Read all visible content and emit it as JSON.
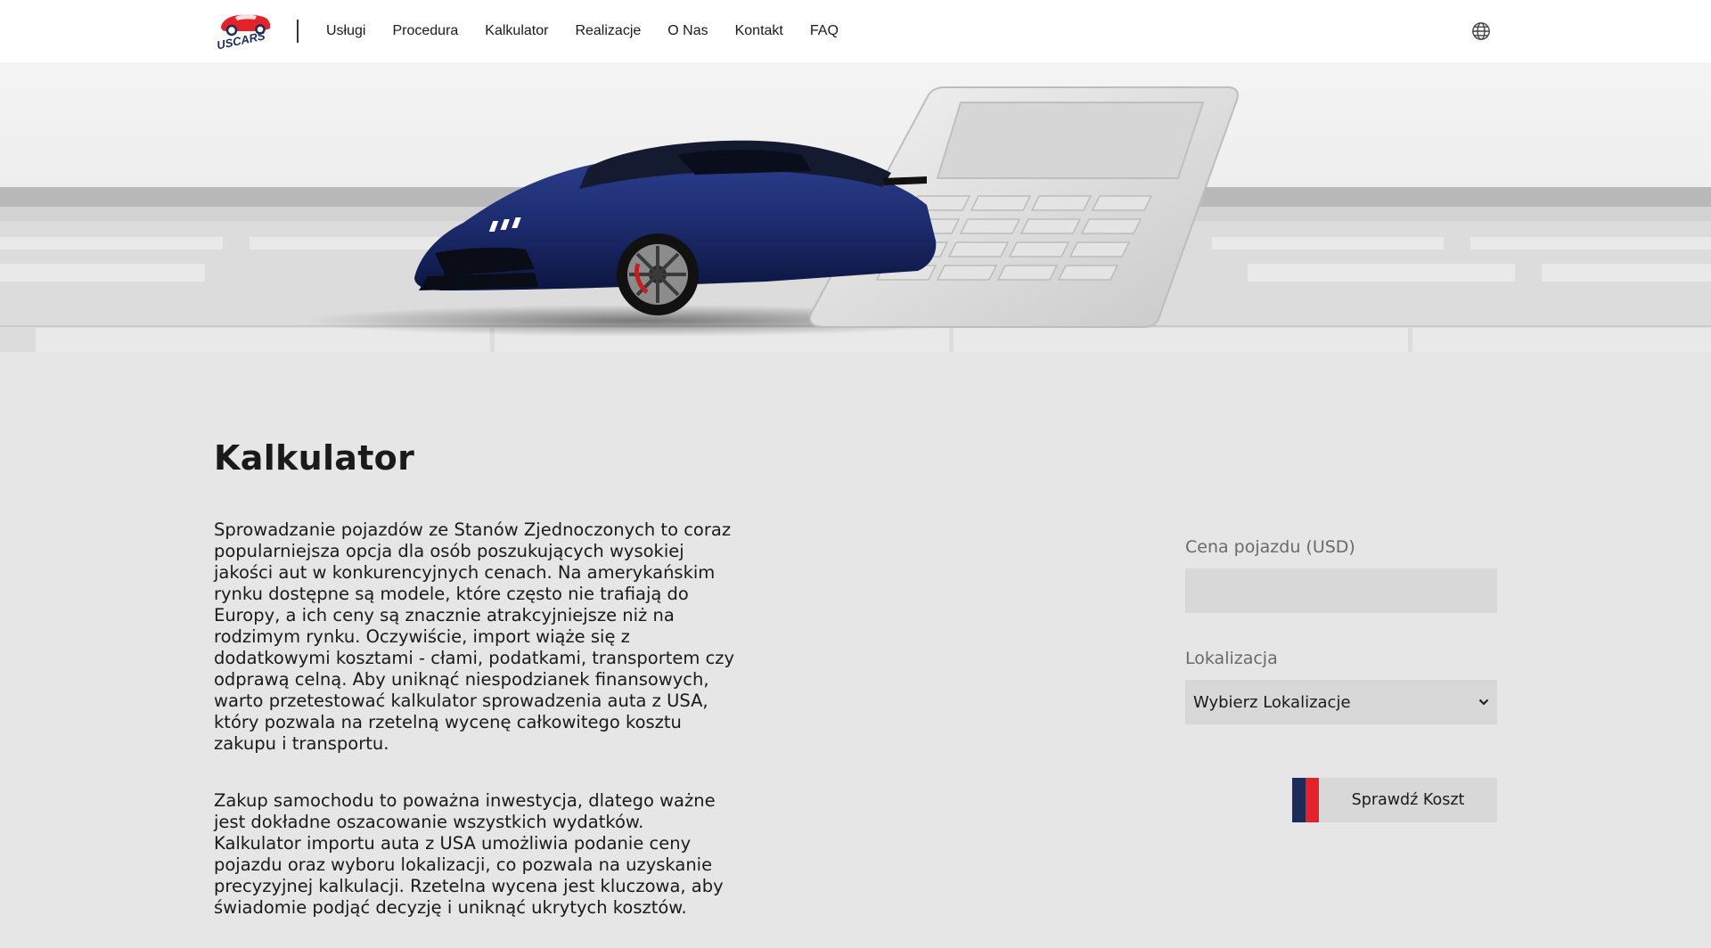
{
  "brand": {
    "logo_text": "USCARS"
  },
  "nav": {
    "items": [
      {
        "label": "Usługi"
      },
      {
        "label": "Procedura"
      },
      {
        "label": "Kalkulator"
      },
      {
        "label": "Realizacje"
      },
      {
        "label": "O Nas"
      },
      {
        "label": "Kontakt"
      },
      {
        "label": "FAQ"
      }
    ],
    "language_icon": "globe-icon"
  },
  "hero": {
    "image": "blue-sports-car-with-calculator"
  },
  "main": {
    "title": "Kalkulator",
    "paragraphs": [
      "Sprowadzanie pojazdów ze Stanów Zjednoczonych to coraz popularniejsza opcja dla osób poszukujących wysokiej jakości aut w konkurencyjnych cenach. Na amerykańskim rynku dostępne są modele, które często nie trafiają do Europy, a ich ceny są znacznie atrakcyjniejsze niż na rodzimym rynku. Oczywiście, import wiąże się z dodatkowymi kosztami - cłami, podatkami, transportem czy odprawą celną. Aby uniknąć niespodzianek finansowych, warto przetestować kalkulator sprowadzenia auta z USA, który pozwala na rzetelną wycenę całkowitego kosztu zakupu i transportu.",
      "Zakup samochodu to poważna inwestycja, dlatego ważne jest dokładne oszacowanie wszystkich wydatków. Kalkulator importu auta z USA umożliwia podanie ceny pojazdu oraz wyboru lokalizacji, co pozwala na uzyskanie precyzyjnej kalkulacji. Rzetelna wycena jest kluczowa, aby świadomie podjąć decyzję i uniknąć ukrytych kosztów."
    ]
  },
  "form": {
    "price_label": "Cena pojazdu (USD)",
    "price_value": "",
    "location_label": "Lokalizacja",
    "location_selected": "Wybierz Lokalizacje",
    "submit_label": "Sprawdź Koszt"
  },
  "colors": {
    "accent_navy": "#1c2b5a",
    "accent_red": "#e3232a",
    "page_bg": "#e6e6e6",
    "field_bg": "#d8d8d8"
  }
}
